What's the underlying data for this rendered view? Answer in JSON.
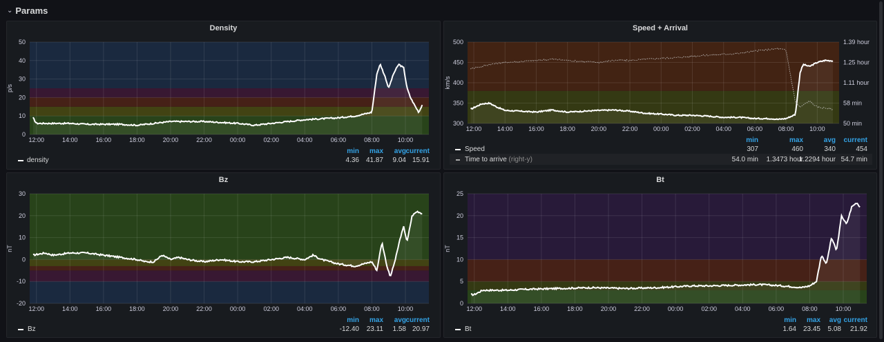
{
  "row": {
    "title": "Params",
    "chevron_icon": "chevron-down-icon"
  },
  "panels": {
    "density": {
      "title": "Density",
      "ylabel": "p/s",
      "legend": {
        "headers": [
          "min",
          "max",
          "avg",
          "current"
        ],
        "series": [
          {
            "name": "density",
            "values": [
              "4.36",
              "41.87",
              "9.04",
              "15.91"
            ]
          }
        ]
      }
    },
    "speed": {
      "title": "Speed + Arrival",
      "ylabel": "km/s",
      "ylabel_right": "Time to arrive",
      "legend": {
        "headers": [
          "min",
          "max",
          "avg",
          "current"
        ],
        "series": [
          {
            "name": "Speed",
            "values": [
              "307",
              "460",
              "340",
              "454"
            ]
          },
          {
            "name": "Time to arrive",
            "tag": "(right-y)",
            "values": [
              "54.0 min",
              "1.3473 hour",
              "1.2294 hour",
              "54.7 min"
            ]
          }
        ]
      }
    },
    "bz": {
      "title": "Bz",
      "ylabel": "nT",
      "legend": {
        "headers": [
          "min",
          "max",
          "avg",
          "current"
        ],
        "series": [
          {
            "name": "Bz",
            "values": [
              "-12.40",
              "23.11",
              "1.58",
              "20.97"
            ]
          }
        ]
      }
    },
    "bt": {
      "title": "Bt",
      "ylabel": "nT",
      "legend": {
        "headers": [
          "min",
          "max",
          "avg",
          "current"
        ],
        "series": [
          {
            "name": "Bt",
            "values": [
              "1.64",
              "23.45",
              "5.08",
              "21.92"
            ]
          }
        ]
      }
    }
  },
  "chart_data": [
    {
      "type": "line",
      "title": "Density",
      "ylabel": "p/s",
      "ylim": [
        0,
        50
      ],
      "yticks": [
        0,
        10,
        20,
        30,
        40,
        50
      ],
      "xticks": [
        "12:00",
        "14:00",
        "16:00",
        "18:00",
        "20:00",
        "22:00",
        "00:00",
        "02:00",
        "04:00",
        "06:00",
        "08:00",
        "10:00"
      ],
      "x_hours": [
        11.8,
        12,
        13,
        14,
        15,
        16,
        17,
        18,
        19,
        20,
        21,
        22,
        23,
        24,
        25,
        26,
        27,
        28,
        29,
        30,
        31,
        31.5,
        32,
        32.3,
        32.5,
        32.8,
        33,
        33.3,
        33.6,
        33.9,
        34.1,
        34.3,
        34.6,
        34.8,
        35
      ],
      "y": [
        9,
        6,
        6,
        6,
        5.5,
        5.5,
        5.5,
        5,
        6,
        7,
        7,
        7,
        6.5,
        6,
        5,
        6,
        7,
        8,
        8.5,
        9,
        10,
        11,
        12,
        33,
        38,
        31,
        25,
        33,
        38,
        36,
        25,
        20,
        15,
        12,
        16
      ],
      "bands": [
        {
          "from": 0,
          "to": 10,
          "color": "#2b4a1a"
        },
        {
          "from": 10,
          "to": 15,
          "color": "#4a4a12"
        },
        {
          "from": 15,
          "to": 20,
          "color": "#4f2216"
        },
        {
          "from": 20,
          "to": 25,
          "color": "#3e1836"
        },
        {
          "from": 25,
          "to": 50,
          "color": "#1b2b45"
        }
      ]
    },
    {
      "type": "line",
      "title": "Speed + Arrival",
      "ylabel": "km/s",
      "ylim": [
        300,
        500
      ],
      "yticks": [
        300,
        350,
        400,
        450,
        500
      ],
      "y2label": "Time to arrive",
      "y2ticks": [
        "50 min",
        "58 min",
        "1.11 hour",
        "1.25 hour",
        "1.39 hour"
      ],
      "xticks": [
        "12:00",
        "14:00",
        "16:00",
        "18:00",
        "20:00",
        "22:00",
        "00:00",
        "02:00",
        "04:00",
        "06:00",
        "08:00",
        "10:00"
      ],
      "series": [
        {
          "name": "Speed",
          "x_hours": [
            11.8,
            12.5,
            13,
            13.5,
            14,
            15,
            16,
            17,
            18,
            19,
            20,
            21,
            22,
            23,
            24,
            25,
            26,
            27,
            28,
            29,
            30,
            31,
            31.5,
            32,
            32.6,
            32.9,
            33.1,
            33.5,
            34,
            34.5,
            35
          ],
          "y": [
            335,
            348,
            350,
            340,
            332,
            330,
            328,
            333,
            328,
            330,
            332,
            333,
            330,
            325,
            323,
            320,
            320,
            318,
            315,
            315,
            312,
            312,
            310,
            312,
            322,
            425,
            445,
            440,
            450,
            455,
            454
          ]
        },
        {
          "name": "Time to arrive",
          "x_hours": [
            11.8,
            12.5,
            13,
            14,
            15,
            16,
            17,
            18,
            19,
            20,
            21,
            22,
            23,
            24,
            25,
            26,
            27,
            28,
            29,
            30,
            31,
            31.5,
            32,
            32.6,
            32.9,
            33.1,
            33.5,
            34,
            34.5,
            35
          ],
          "y": [
            435,
            440,
            445,
            450,
            452,
            455,
            458,
            455,
            452,
            450,
            455,
            455,
            458,
            460,
            462,
            465,
            468,
            470,
            472,
            478,
            482,
            484,
            480,
            352,
            340,
            345,
            355,
            340,
            338,
            335
          ]
        }
      ],
      "bands": [
        {
          "from": 300,
          "to": 380,
          "color": "#3a3e12"
        },
        {
          "from": 380,
          "to": 500,
          "color": "#4a2512"
        }
      ]
    },
    {
      "type": "line",
      "title": "Bz",
      "ylabel": "nT",
      "ylim": [
        -20,
        30
      ],
      "yticks": [
        -20,
        -10,
        0,
        10,
        20,
        30
      ],
      "xticks": [
        "12:00",
        "14:00",
        "16:00",
        "18:00",
        "20:00",
        "22:00",
        "00:00",
        "02:00",
        "04:00",
        "06:00",
        "08:00",
        "10:00"
      ],
      "x_hours": [
        11.8,
        12.5,
        13,
        14,
        15,
        16,
        17,
        18,
        18.5,
        19,
        19.5,
        20,
        20.5,
        21,
        22,
        23,
        24,
        25,
        26,
        27,
        28,
        28.5,
        29,
        30,
        31,
        31.5,
        32,
        32.3,
        32.6,
        32.9,
        33.1,
        33.4,
        33.7,
        33.9,
        34.1,
        34.4,
        34.7,
        35
      ],
      "y": [
        2,
        3,
        2,
        3,
        3,
        2,
        1,
        0,
        -1,
        -1,
        2,
        0,
        1,
        0,
        -1,
        0,
        -1,
        -1,
        0,
        1,
        0,
        2,
        0,
        -2,
        -3,
        -2,
        -1,
        -5,
        8,
        -3,
        -8,
        0,
        10,
        15,
        8,
        20,
        22,
        21
      ],
      "bands": [
        {
          "from": -20,
          "to": -10,
          "color": "#1b2b45"
        },
        {
          "from": -10,
          "to": -5,
          "color": "#3e1836"
        },
        {
          "from": -5,
          "to": -3,
          "color": "#4f2216"
        },
        {
          "from": -3,
          "to": 0,
          "color": "#4a4a12"
        },
        {
          "from": 0,
          "to": 30,
          "color": "#2b4a1a"
        }
      ]
    },
    {
      "type": "line",
      "title": "Bt",
      "ylabel": "nT",
      "ylim": [
        0,
        25
      ],
      "yticks": [
        0,
        5,
        10,
        15,
        20,
        25
      ],
      "xticks": [
        "12:00",
        "14:00",
        "16:00",
        "18:00",
        "20:00",
        "22:00",
        "00:00",
        "02:00",
        "04:00",
        "06:00",
        "08:00",
        "10:00"
      ],
      "x_hours": [
        11.8,
        12,
        12.5,
        13,
        14,
        15,
        16,
        17,
        18,
        19,
        20,
        21,
        22,
        23,
        24,
        25,
        26,
        27,
        28,
        29,
        30,
        31,
        31.5,
        32,
        32.4,
        32.7,
        33,
        33.3,
        33.6,
        33.9,
        34.2,
        34.5,
        34.8,
        35
      ],
      "y": [
        2,
        2,
        3,
        3,
        3,
        3.2,
        3.3,
        3.4,
        3.5,
        3.6,
        3.5,
        3.4,
        3.5,
        3.6,
        3.8,
        4,
        4,
        4.1,
        4.2,
        4.3,
        4.1,
        3.8,
        3.6,
        4,
        5,
        11,
        9,
        15,
        12,
        20,
        18,
        22,
        23,
        22
      ],
      "bands": [
        {
          "from": 0,
          "to": 3,
          "color": "#2b4a1a"
        },
        {
          "from": 3,
          "to": 5,
          "color": "#3a3e12"
        },
        {
          "from": 5,
          "to": 10,
          "color": "#4f2216"
        },
        {
          "from": 10,
          "to": 25,
          "color": "#2c1a3e"
        }
      ]
    }
  ]
}
